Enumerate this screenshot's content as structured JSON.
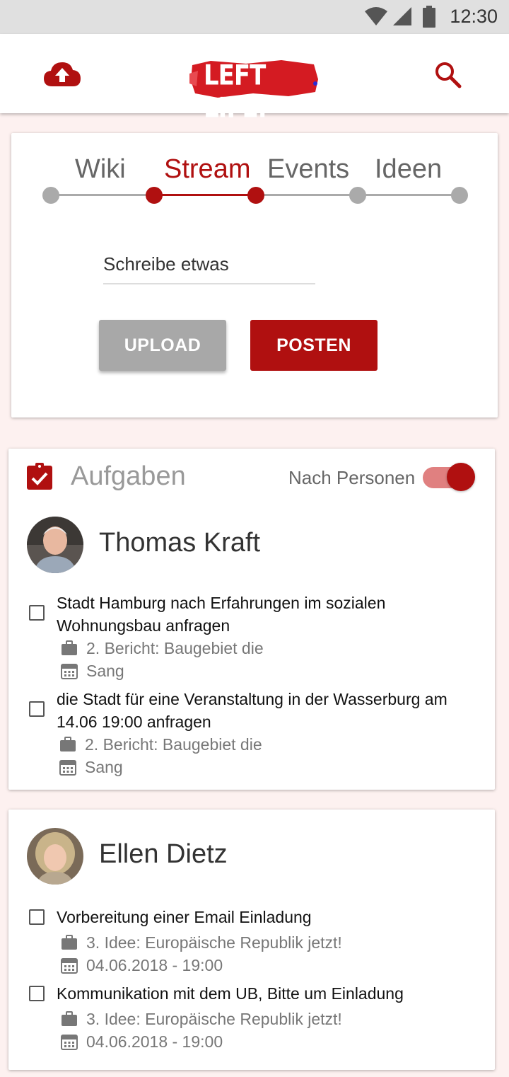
{
  "status_bar": {
    "time": "12:30"
  },
  "app_bar": {
    "logo_text": "LEFT LIFE."
  },
  "composer": {
    "tabs": [
      {
        "label": "Wiki"
      },
      {
        "label": "Stream"
      },
      {
        "label": "Events"
      },
      {
        "label": "Ideen"
      }
    ],
    "active_tab": "Stream",
    "input_value": "Schreibe etwas",
    "upload_label": "UPLOAD",
    "post_label": "POSTEN"
  },
  "tasks": {
    "title": "Aufgaben",
    "toggle_label": "Nach Personen",
    "toggle_on": true,
    "people": [
      {
        "name": "Thomas Kraft",
        "items": [
          {
            "title": "Stadt Hamburg nach Erfahrungen im sozialen Wohnungsbau anfragen",
            "project": "2. Bericht: Baugebiet die",
            "date": "Sang"
          },
          {
            "title": "die Stadt für eine Veranstaltung in der Wasserburg am 14.06 19:00 anfragen",
            "project": "2. Bericht: Baugebiet die",
            "date": "Sang"
          }
        ]
      },
      {
        "name": "Ellen Dietz",
        "items": [
          {
            "title": "Vorbereitung einer Email Einladung",
            "project": "3. Idee: Europäische Republik jetzt!",
            "date": "04.06.2018 - 19:00"
          },
          {
            "title": "Kommunikation mit dem UB, Bitte um Einladung",
            "project": "3. Idee: Europäische Republik jetzt!",
            "date": "04.06.2018 - 19:00"
          }
        ]
      }
    ]
  },
  "colors": {
    "accent": "#b01010",
    "toggle_track": "#e08080",
    "page_bg": "#fdf1f0"
  }
}
